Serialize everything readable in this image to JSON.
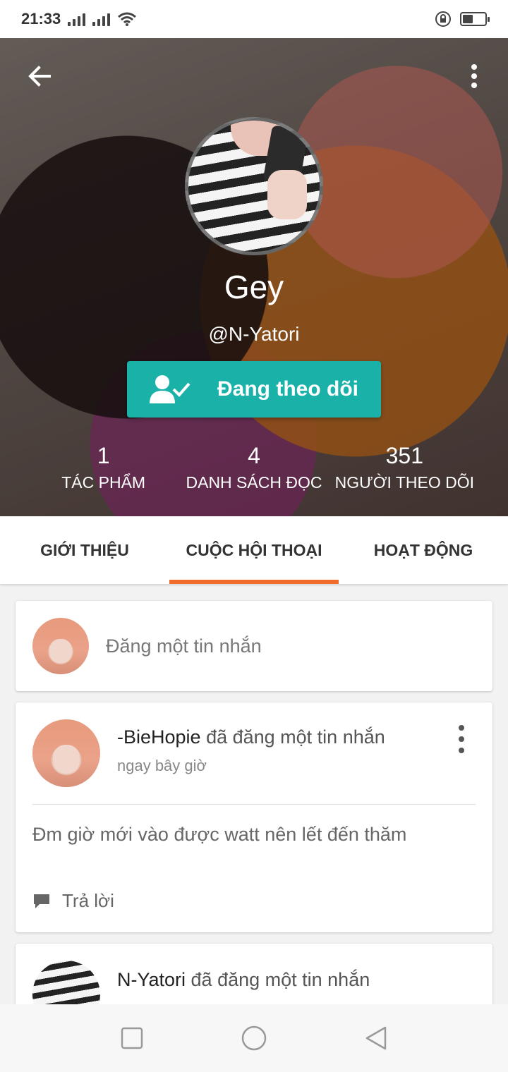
{
  "status_bar": {
    "time": "21:33"
  },
  "profile": {
    "display_name": "Gey",
    "username": "@N-Yatori",
    "follow_button_label": "Đang theo dõi",
    "stats": [
      {
        "value": "1",
        "label": "TÁC PHẨM"
      },
      {
        "value": "4",
        "label": "DANH SÁCH ĐỌC"
      },
      {
        "value": "351",
        "label": "NGƯỜI THEO DÕI"
      }
    ]
  },
  "tabs": [
    {
      "label": "GIỚI THIỆU",
      "active": false
    },
    {
      "label": "CUỘC HỘI THOẠI",
      "active": true
    },
    {
      "label": "HOẠT ĐỘNG",
      "active": false
    }
  ],
  "compose": {
    "placeholder": "Đăng một tin nhắn"
  },
  "posts": [
    {
      "author": "-BieHopie",
      "action": " đã đăng một tin nhắn",
      "time": "ngay bây giờ",
      "body": "Đm giờ mới vào được watt nên lết đến thăm",
      "reply_label": "Trả lời"
    },
    {
      "author": "N-Yatori",
      "action": " đã đăng một tin nhắn"
    }
  ],
  "colors": {
    "accent": "#f26b2a",
    "follow_button": "#1ab2a8"
  },
  "icons": [
    "back-arrow-icon",
    "more-vert-icon",
    "user-check-icon",
    "comment-icon",
    "nav-recents-icon",
    "nav-home-icon",
    "nav-back-icon"
  ]
}
